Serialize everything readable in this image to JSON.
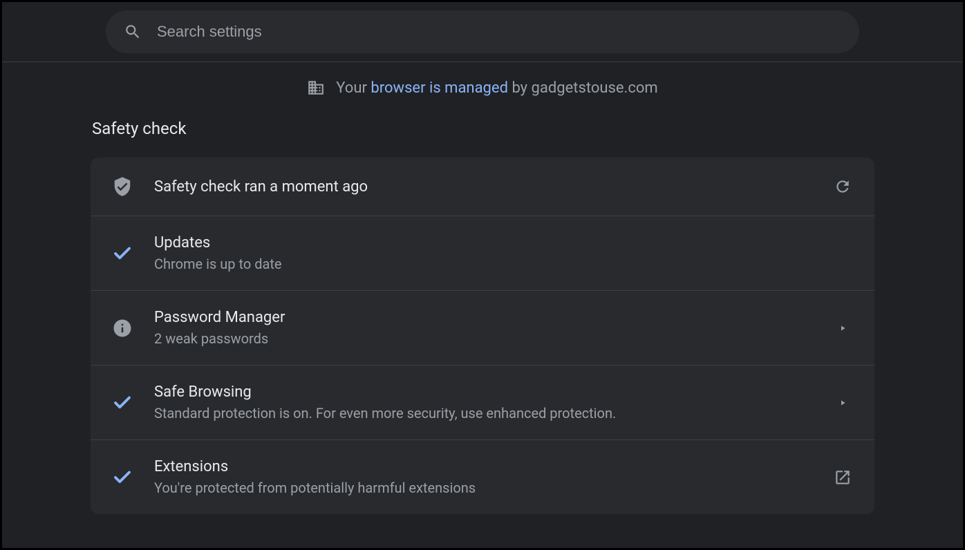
{
  "search": {
    "placeholder": "Search settings"
  },
  "managed": {
    "prefix": "Your ",
    "link": "browser is managed",
    "suffix": " by gadgetstouse.com"
  },
  "section": {
    "title": "Safety check"
  },
  "rows": {
    "header": {
      "title": "Safety check ran a moment ago"
    },
    "updates": {
      "title": "Updates",
      "sub": "Chrome is up to date"
    },
    "passwords": {
      "title": "Password Manager",
      "sub": "2 weak passwords"
    },
    "safebrowsing": {
      "title": "Safe Browsing",
      "sub": "Standard protection is on. For even more security, use enhanced protection."
    },
    "extensions": {
      "title": "Extensions",
      "sub": "You're protected from potentially harmful extensions"
    }
  }
}
